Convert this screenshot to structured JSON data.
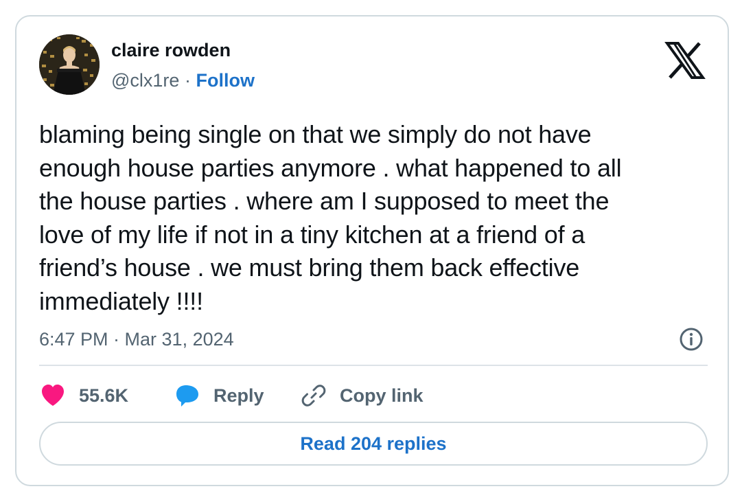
{
  "user": {
    "display_name": "claire rowden",
    "handle": "@clx1re",
    "separator": "·",
    "follow_label": "Follow"
  },
  "tweet": {
    "text": "blaming being single on that we simply do not have\nenough house parties anymore . what happened to all\nthe house parties . where am I supposed to meet the\nlove of my life if not in a tiny kitchen at a friend of a\nfriend’s house . we must bring them back effective\nimmediately !!!!",
    "timestamp": "6:47 PM · Mar 31, 2024"
  },
  "actions": {
    "like_count": "55.6K",
    "reply_label": "Reply",
    "copy_link_label": "Copy link"
  },
  "read_replies_label": "Read 204 replies",
  "icons": {
    "brand": "x-logo-icon",
    "info": "info-icon",
    "like": "heart-icon",
    "reply": "speech-bubble-icon",
    "copy_link": "link-icon"
  },
  "colors": {
    "link_blue": "#1d72c9",
    "heart_pink": "#f91880",
    "reply_blue": "#1d9bf0",
    "text_primary": "#0f1419",
    "text_secondary": "#536471",
    "border": "#cfd9de"
  }
}
